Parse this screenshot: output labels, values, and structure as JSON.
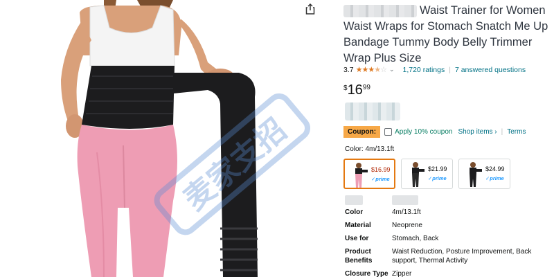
{
  "product": {
    "title": "Waist Trainer for Women Waist Wraps for Stomach Snatch Me Up Bandage Tummy Body Belly Trimmer Wrap Plus Size",
    "rating": "3.7",
    "rating_count": "1,720 ratings",
    "answered_questions": "7 answered questions",
    "price_symbol": "$",
    "price_whole": "16",
    "price_fraction": "99"
  },
  "coupon": {
    "badge": "Coupon:",
    "text": "Apply 10% coupon",
    "shop_items": "Shop items ›",
    "terms": "Terms"
  },
  "color": {
    "label": "Color: 4m/13.1ft",
    "swatches": [
      {
        "price": "$16.99",
        "prime": "✓prime",
        "selected": true
      },
      {
        "price": "$21.99",
        "prime": "✓prime",
        "selected": false
      },
      {
        "price": "$24.99",
        "prime": "✓prime",
        "selected": false
      }
    ]
  },
  "specs": [
    {
      "key": "Color",
      "value": "4m/13.1ft"
    },
    {
      "key": "Material",
      "value": "Neoprene"
    },
    {
      "key": "Use for",
      "value": "Stomach, Back"
    },
    {
      "key": "Product Benefits",
      "value": "Waist Reduction, Posture Improvement, Back support, Thermal Activity"
    },
    {
      "key": "Closure Type",
      "value": "Zipper"
    }
  ],
  "icons": {
    "share": "share-icon",
    "stars": "star-rating-icon",
    "chevron": "chevron-down-icon",
    "checkbox": "checkbox-icon"
  },
  "colors": {
    "link": "#007185",
    "star": "#de7921",
    "coupon_badge": "#f7a847",
    "coupon_text": "#067d62",
    "selected_border": "#e47911",
    "sale_price": "#b12704",
    "leggings": "#ee9db4",
    "wrap_band": "#1c1c1e",
    "watermark": "#5a8bd4"
  },
  "watermark": "麦家支招"
}
